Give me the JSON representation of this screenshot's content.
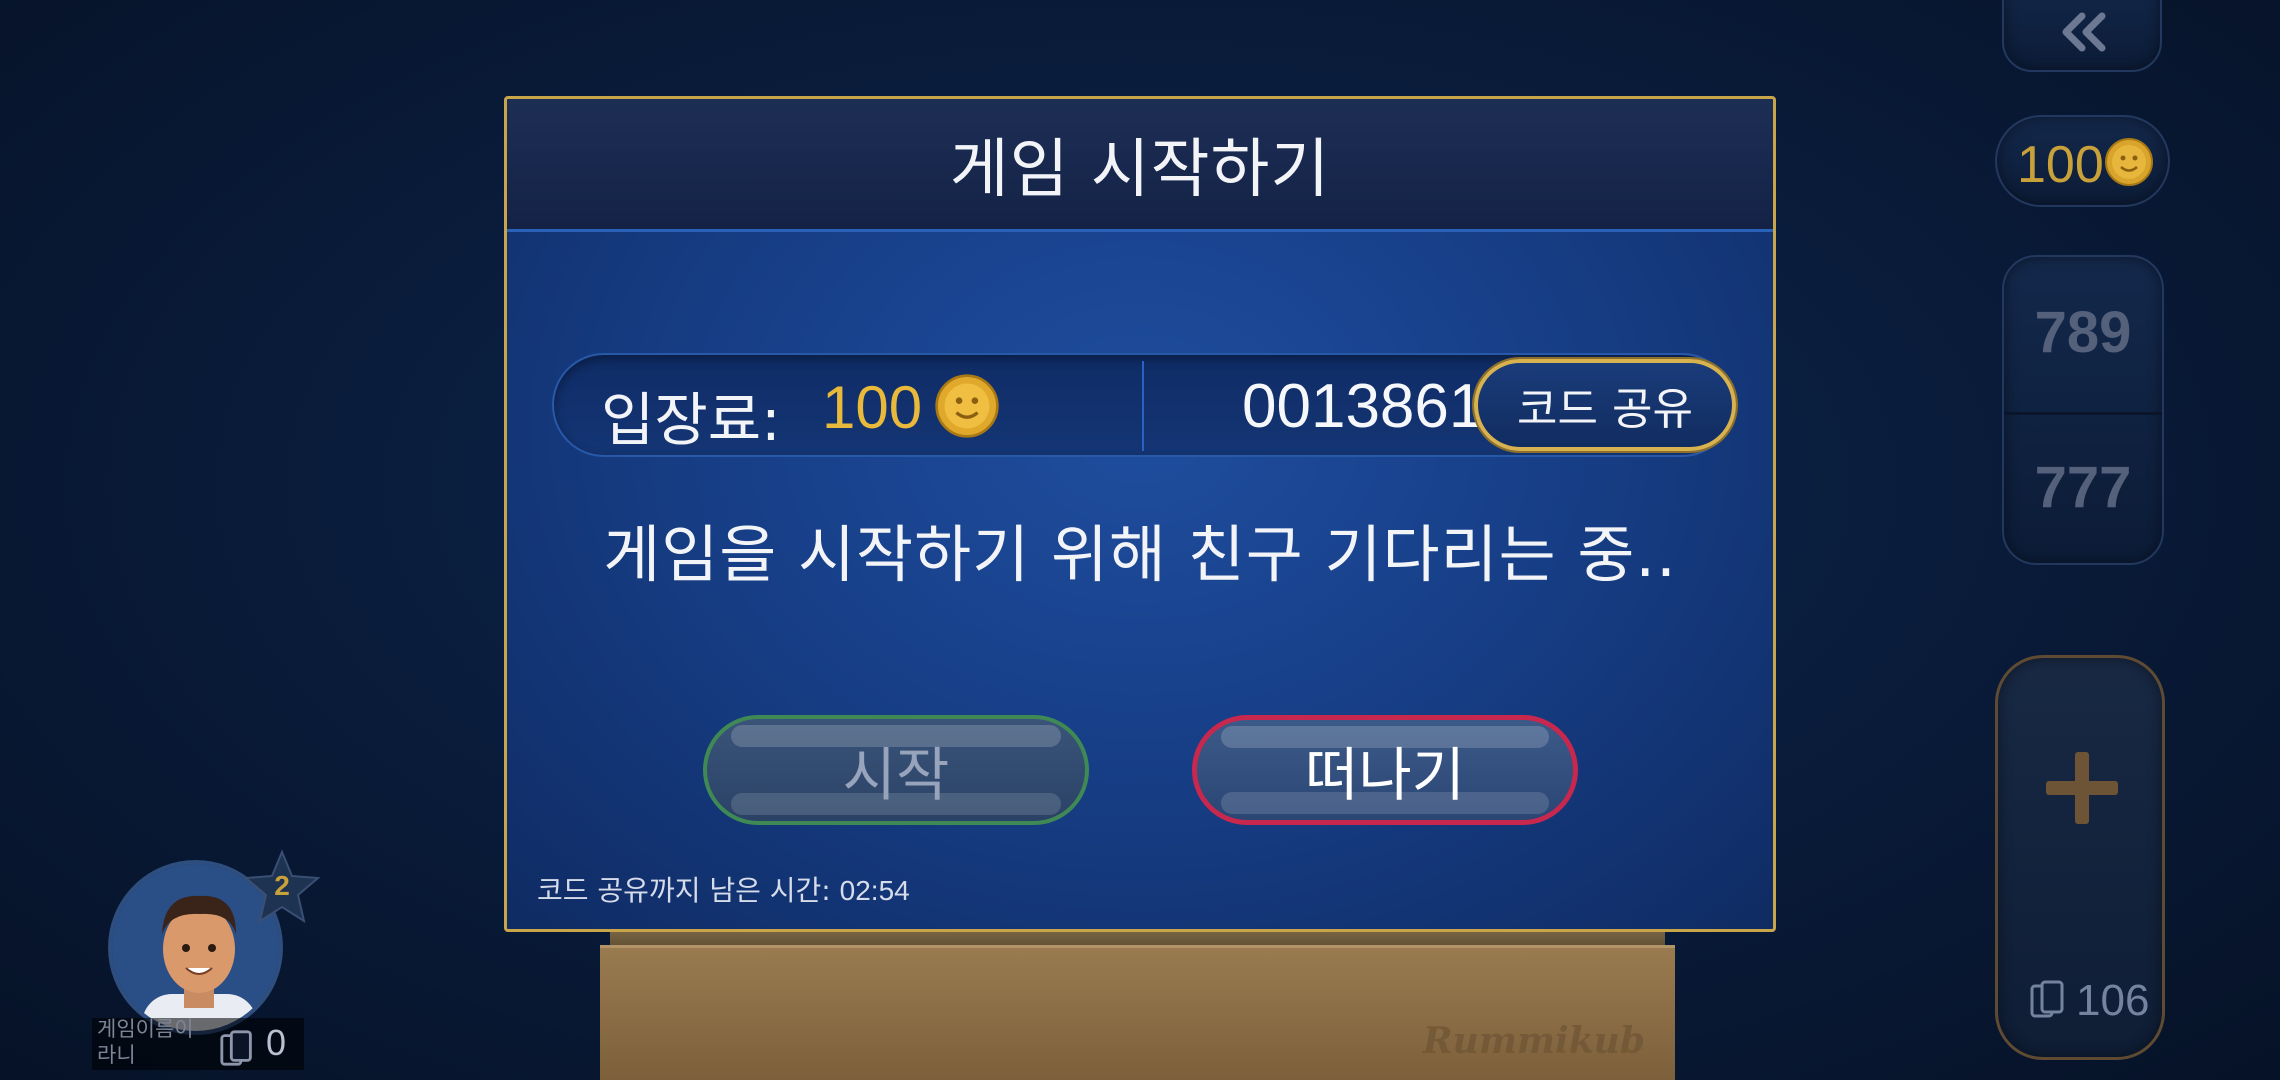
{
  "modal": {
    "title": "게임 시작하기",
    "entry_fee_label": "입장료:",
    "entry_fee_value": "100",
    "room_code": "0013861",
    "share_code_label": "코드 공유",
    "waiting_message": "게임을 시작하기 위해 친구 기다리는 중..",
    "start_label": "시작",
    "leave_label": "떠나기",
    "timer_label": "코드 공유까지 남은 시간:",
    "timer_value": "02:54"
  },
  "right_rail": {
    "back_icon": "double-chevron-left-icon",
    "coins": "100",
    "score_top": "789",
    "score_bottom": "777",
    "pile_count": "106"
  },
  "player": {
    "name": "게임이름이 라니",
    "level": "2",
    "tile_count": "0"
  },
  "board": {
    "brand": "Rummikub"
  },
  "colors": {
    "gold": "#c9a54a",
    "coin_text": "#e8b93a",
    "start_border": "#3f8a54",
    "leave_border": "#c8274e",
    "modal_bg": "#173f88"
  }
}
